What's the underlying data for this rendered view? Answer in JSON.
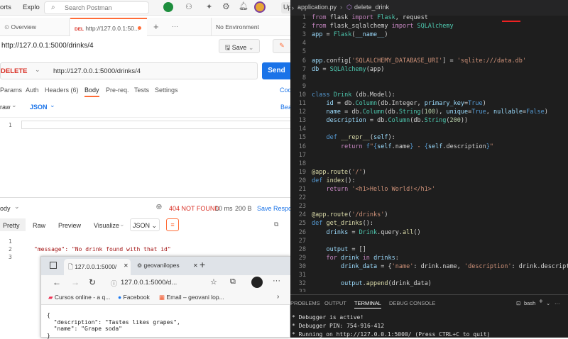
{
  "postman": {
    "menu": [
      "orts",
      "Explo"
    ],
    "search_placeholder": "Search Postman",
    "upgrade": "Up",
    "tabs": {
      "overview": "Overview",
      "request_method": "DEL",
      "request_url": "http://127.0.0.1:50...",
      "env": "No Environment"
    },
    "request_title": "http://127.0.0.1:5000/drinks/4",
    "save": "Save",
    "method": "DELETE",
    "url": "http://127.0.0.1:5000/drinks/4",
    "send": "Send",
    "subtabs": [
      "Params",
      "Auth",
      "Headers (6)",
      "Body",
      "Pre-req.",
      "Tests",
      "Settings"
    ],
    "cookies": "Coo",
    "body_type": "raw",
    "body_format": "JSON",
    "beautify": "Bea",
    "editor_line": "1",
    "response": {
      "body_label": "ody",
      "status": "404 NOT FOUND",
      "time": "10 ms",
      "size": "200 B",
      "save": "Save Respo",
      "tabs": [
        "Pretty",
        "Raw",
        "Preview",
        "Visualize"
      ],
      "format": "JSON",
      "lines": [
        "1",
        "2",
        "3"
      ],
      "line2": "\"message\": \"No drink found with that id\""
    }
  },
  "edge": {
    "tab1": "127.0.0.1:5000/",
    "tab2": "geovanilopes",
    "address": "127.0.0.1:5000/d...",
    "favorites": [
      "Cursos online - a q...",
      "Facebook",
      "Email – geovani lop..."
    ],
    "json_lines": [
      "{",
      "  \"description\": \"Tastes likes grapes\",",
      "  \"name\": \"Grape soda\"",
      "}"
    ]
  },
  "vscode": {
    "file_tab": "application.py",
    "breadcrumb": "delete_drink",
    "line_numbers": [
      "1",
      "2",
      "3",
      "4",
      "5",
      "6",
      "7",
      "8",
      "9",
      "10",
      "11",
      "12",
      "13",
      "14",
      "15",
      "16",
      "17",
      "18",
      "19",
      "20",
      "21",
      "22",
      "23",
      "24",
      "25",
      "26",
      "27",
      "28",
      "29",
      "30",
      "31",
      "32",
      "33"
    ],
    "terminal_tabs": [
      "PROBLEMS",
      "OUTPUT",
      "TERMINAL",
      "DEBUG CONSOLE"
    ],
    "shell": "bash",
    "terminal_lines": [
      "* Debugger is active!",
      "* Debugger PIN: 754-916-412",
      "* Running on http://127.0.0.1:5000/ (Press CTRL+C to quit)"
    ]
  },
  "colors": {
    "send": "#1a73e8",
    "status_error": "#d93025",
    "vs_bg": "#1e1e1e"
  }
}
